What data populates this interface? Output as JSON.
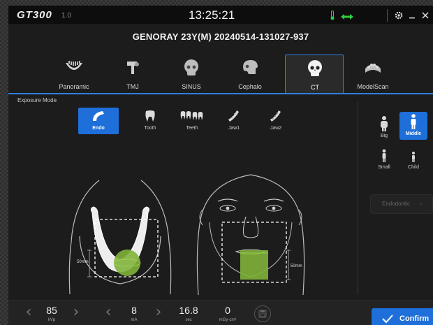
{
  "app": {
    "brand": "GT300",
    "version": "1.0",
    "clock": "13:25:21"
  },
  "patient": {
    "info": "GENORAY   23Y(M)  20240514-131027-937"
  },
  "tabs": [
    {
      "label": "Panoramic",
      "icon": "panoramic-arch-icon",
      "active": false
    },
    {
      "label": "TMJ",
      "icon": "tmj-icon",
      "active": false
    },
    {
      "label": "SINUS",
      "icon": "skull-icon",
      "active": false
    },
    {
      "label": "Cephalo",
      "icon": "skull-side-icon",
      "active": false
    },
    {
      "label": "CT",
      "icon": "skull-front-icon",
      "active": true
    },
    {
      "label": "ModelScan",
      "icon": "dental-model-icon",
      "active": false
    }
  ],
  "exposure": {
    "title": "Exposure Mode",
    "items": [
      {
        "label": "Endo",
        "icon": "endo-icon",
        "selected": true
      },
      {
        "label": "Tooth",
        "icon": "tooth-icon",
        "selected": false
      },
      {
        "label": "Teeth",
        "icon": "teeth-icon",
        "selected": false
      },
      {
        "label": "Jaw1",
        "icon": "jaw-icon",
        "selected": false
      },
      {
        "label": "Jaw2",
        "icon": "jaw-icon",
        "selected": false
      }
    ]
  },
  "patient_size": [
    {
      "label": "Big",
      "icon": "person-big-icon",
      "selected": false
    },
    {
      "label": "Middle",
      "icon": "person-middle-icon",
      "selected": true
    },
    {
      "label": "Small",
      "icon": "person-small-icon",
      "selected": false
    },
    {
      "label": "Child",
      "icon": "person-child-icon",
      "selected": false
    }
  ],
  "endodontic": {
    "label": "Endodontic",
    "enabled": false
  },
  "fov": {
    "side_dim": "50mm",
    "front_dim": "50mm",
    "accent": "#7fb33a"
  },
  "params": [
    {
      "value": "85",
      "unit": "kVp"
    },
    {
      "value": "8",
      "unit": "mA"
    },
    {
      "value": "16.8",
      "unit": "sec"
    },
    {
      "value": "0",
      "unit": "mGy·cm²"
    }
  ],
  "confirm": {
    "label": "Confirm"
  },
  "colors": {
    "accent": "#1e6fd9",
    "green_status": "#2ecc40"
  }
}
